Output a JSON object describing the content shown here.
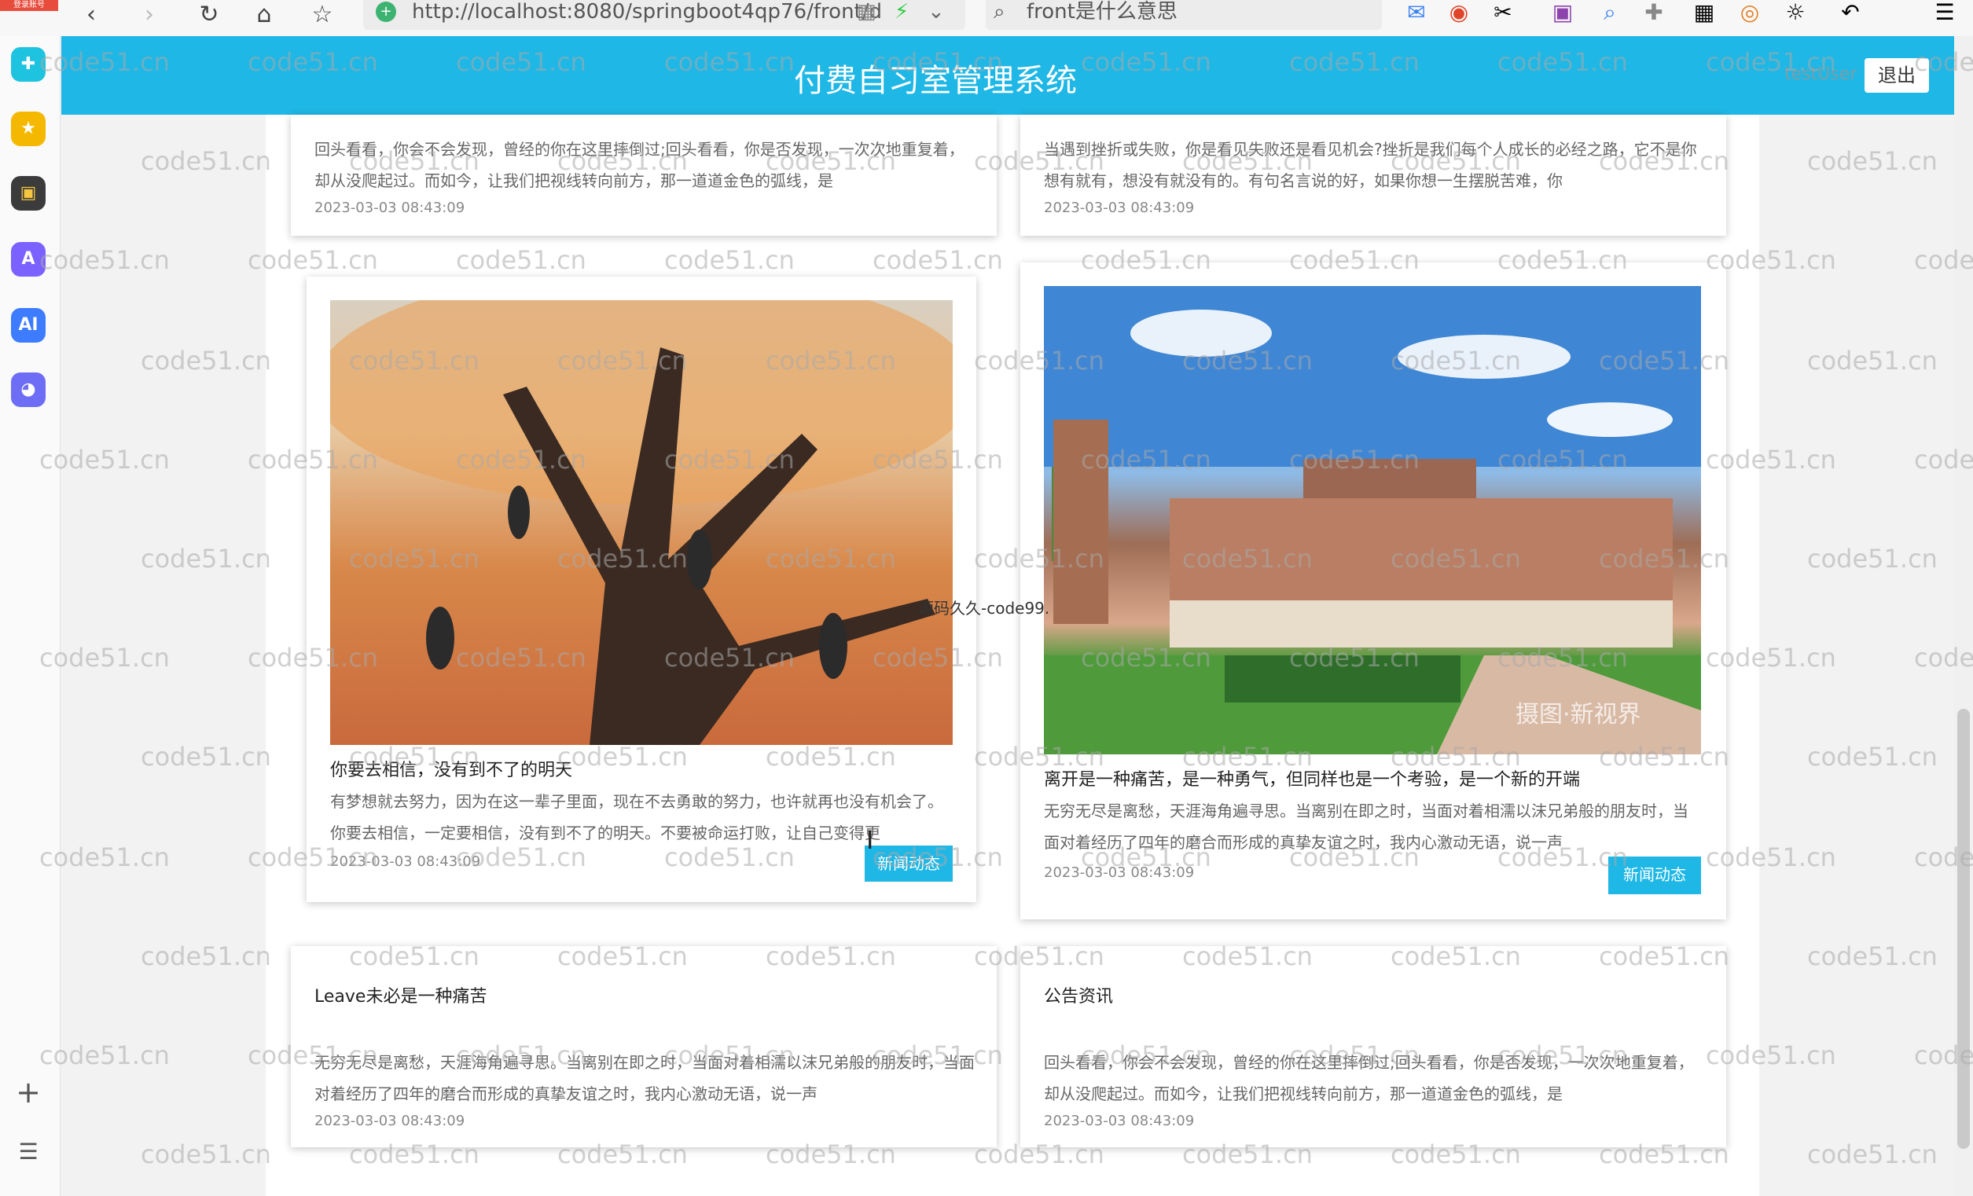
{
  "browser": {
    "url": "http://localhost:8080/springboot4qp76/front/d",
    "search_query": "front是什么意思"
  },
  "dock": {
    "top_badge": "登录账号"
  },
  "header": {
    "title": "付费自习室管理系统",
    "username": "testUser",
    "logout_label": "退出"
  },
  "cards": [
    {
      "desc": "回头看看，你会不会发现，曾经的你在这里摔倒过;回头看看，你是否发现，一次次地重复着，却从没爬起过。而如今，让我们把视线转向前方，那一道道金色的弧线，是",
      "time": "2023-03-03 08:43:09"
    },
    {
      "desc": "当遇到挫折或失败，你是看见失败还是看见机会?挫折是我们每个人成长的必经之路，它不是你想有就有，想没有就没有的。有句名言说的好，如果你想一生摆脱苦难，你",
      "time": "2023-03-03 08:43:09"
    },
    {
      "title": "你要去相信，没有到不了的明天",
      "desc": "有梦想就去努力，因为在这一辈子里面，现在不去勇敢的努力，也许就再也没有机会了。你要去相信，一定要相信，没有到不了的明天。不要被命运打败，让自己变得更",
      "time": "2023-03-03 08:43:09",
      "tag": "新闻动态"
    },
    {
      "title": "离开是一种痛苦，是一种勇气，但同样也是一个考验，是一个新的开端",
      "desc": "无穷无尽是离愁，天涯海角遍寻思。当离别在即之时，当面对着相濡以沫兄弟般的朋友时，当面对着经历了四年的磨合而形成的真挚友谊之时，我内心激动无语，说一声",
      "time": "2023-03-03 08:43:09",
      "tag": "新闻动态"
    },
    {
      "title": "Leave未必是一种痛苦",
      "desc": "无穷无尽是离愁，天涯海角遍寻思。当离别在即之时，当面对着相濡以沫兄弟般的朋友时，当面对着经历了四年的磨合而形成的真挚友谊之时，我内心激动无语，说一声",
      "time": "2023-03-03 08:43:09"
    },
    {
      "title": "公告资讯",
      "desc": "回头看看，你会不会发现，曾经的你在这里摔倒过;回头看看，你是否发现，一次次地重复着，却从没爬起过。而如今，让我们把视线转向前方，那一道道金色的弧线，是",
      "time": "2023-03-03 08:43:09"
    }
  ],
  "overlay": {
    "source_text": "源码久久-code99."
  },
  "image_watermark": "摄图·新视界",
  "watermark": "code51.cn",
  "colors": {
    "accent": "#1fb7e5"
  }
}
